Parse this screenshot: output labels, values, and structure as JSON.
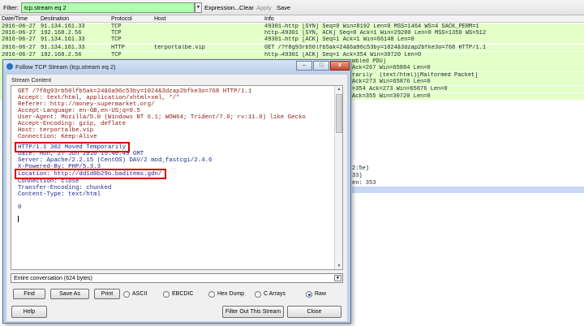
{
  "toolbar": {
    "filter_label": "Filter:",
    "filter_value": "tcp.stream eq 2",
    "dropdown_glyph": "▾",
    "expression_label": "Expression...",
    "clear_label": "Clear",
    "apply_label": "Apply",
    "save_label": "Save"
  },
  "packet_list": {
    "columns": [
      "Date/Time",
      "Destination",
      "Protocol",
      "Host",
      "Info"
    ],
    "rows": [
      {
        "time": "2016-06-27",
        "dest": "91.134.161.33",
        "proto": "TCP",
        "host": "",
        "info": "49301→http [SYN] Seq=0 Win=8192 Len=0 MSS=1464 WS=4 SACK_PERM=1"
      },
      {
        "time": "2016-06-27",
        "dest": "192.168.2.56",
        "proto": "TCP",
        "host": "",
        "info": "http→49301 [SYN, ACK] Seq=0 Ack=1 Win=29200 Len=0 MSS=1350 WS=512"
      },
      {
        "time": "2016-06-27",
        "dest": "91.134.161.33",
        "proto": "TCP",
        "host": "",
        "info": "49301→http [ACK] Seq=1 Ack=1 Win=66148 Len=0"
      },
      {
        "time": "2016-06-27",
        "dest": "91.134.161.33",
        "proto": "HTTP",
        "host": "terportalbe.vip",
        "info": "GET /?f8g93rb50lfb5ak=24&6a96c53by=1024&3dzap2bfke3o=768 HTTP/1.1"
      },
      {
        "time": "2016-06-27",
        "dest": "192.168.2.56",
        "proto": "TCP",
        "host": "",
        "info": "http→49301 [ACK] Seq=1 Ack=354 Win=30720 Len=0"
      }
    ],
    "bg_info_fragments": [
      "mbled PDU]",
      "Ack=267 Win=65884 Len=0",
      "rarily  (text/html)[Malformed Packet]",
      "Ack=273 Win=65876 Len=0",
      "=354 Ack=273 Win=65876 Len=0",
      "Ack=355 Win=30720 Len=0"
    ],
    "bg_detail_fragments": [
      "2:5e)",
      "33)",
      "en: 353"
    ]
  },
  "dialog": {
    "title": "Follow TCP Stream (tcp.stream eq 2)",
    "minimize": "–",
    "maximize": "□",
    "close": "x",
    "frame_label": "Stream Content",
    "request_lines": [
      "GET /?f8g93rb50lfb5ak=24&6a96c53by=1024&3dzap2bfke3o=768 HTTP/1.1",
      "Accept: text/html, application/xhtml+xml, */*",
      "Referer: http://money-supermarket.org/",
      "Accept-Language: en-GB,en-US;q=0.5",
      "User-Agent: Mozilla/5.0 (Windows NT 6.1; WOW64; Trident/7.0; rv:11.0) like Gecko",
      "Accept-Encoding: gzip, deflate",
      "Host: terportalbe.vip",
      "Connection: Keep-Alive"
    ],
    "response_lines": [
      "HTTP/1.1 302 Moved Temporarily",
      "Date: Mon, 27 Jun 2016 15:40:49 GMT",
      "Server: Apache/2.2.15 (CentOS) DAV/2 mod_fastcgi/2.4.6",
      "X-Powered-By: PHP/5.3.3",
      "Location: http://dd1d0b29o.baditems.gdn/",
      "Connection: close",
      "Transfer-Encoding: chunked",
      "Content-Type: text/html",
      "",
      "0"
    ],
    "conversation_select": "Entire conversation (624 bytes)",
    "find_label": "Find",
    "save_as_label": "Save As",
    "print_label": "Print",
    "format_options": [
      "ASCII",
      "EBCDIC",
      "Hex Dump",
      "C Arrays",
      "Raw"
    ],
    "selected_format": "Raw",
    "help_label": "Help",
    "filter_out_label": "Filter Out This Stream",
    "close_label": "Close"
  },
  "colors": {
    "filter_ok_bg": "#afffaf",
    "tcp_row_bg": "#e4ffc7",
    "client_text": "#8b1a10",
    "server_text": "#1a2a8a",
    "highlight_box": "#d40000"
  }
}
